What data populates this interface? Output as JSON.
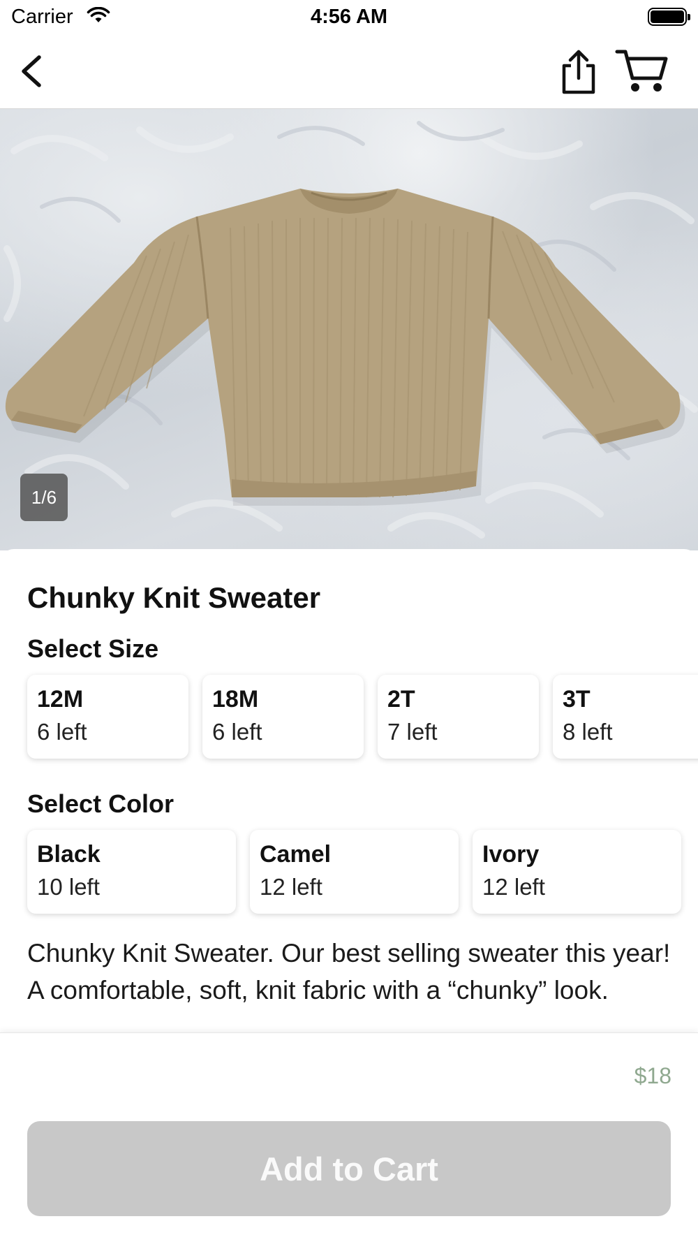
{
  "status_bar": {
    "carrier": "Carrier",
    "time": "4:56 AM"
  },
  "nav": {
    "back_icon": "chevron-left-icon",
    "share_icon": "share-icon",
    "cart_icon": "cart-icon"
  },
  "gallery": {
    "counter": "1/6",
    "image": "beige chunky knit sweater on grey fur rug"
  },
  "product": {
    "title": "Chunky Knit Sweater",
    "size_label": "Select Size",
    "sizes": [
      {
        "name": "12M",
        "stock": "6 left"
      },
      {
        "name": "18M",
        "stock": "6 left"
      },
      {
        "name": "2T",
        "stock": "7 left"
      },
      {
        "name": "3T",
        "stock": "8 left"
      }
    ],
    "color_label": "Select Color",
    "colors": [
      {
        "name": "Black",
        "stock": "10 left"
      },
      {
        "name": "Camel",
        "stock": "12 left"
      },
      {
        "name": "Ivory",
        "stock": "12 left"
      }
    ],
    "description": "Chunky Knit Sweater. Our best selling sweater this year! A comfortable, soft, knit fabric with a “chunky” look."
  },
  "footer": {
    "price": "$18",
    "add_to_cart_label": "Add to Cart"
  },
  "colors": {
    "price_color": "#8fa88f",
    "button_disabled": "#c8c8c8",
    "sweater": "#b5a27f"
  }
}
